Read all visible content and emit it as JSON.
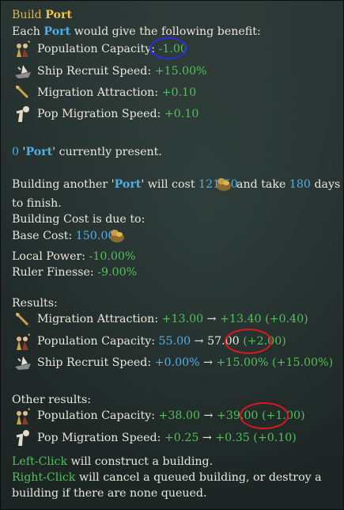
{
  "title": {
    "prefix": "Build",
    "name": "Port"
  },
  "benefit_intro": {
    "pre": "Each",
    "name": "Port",
    "post": "would give the following benefit:"
  },
  "benefits": [
    {
      "icon": "population-icon",
      "label": "Population Capacity:",
      "value": "-1.00"
    },
    {
      "icon": "ship-icon",
      "label": "Ship Recruit Speed:",
      "value": "+15.00%"
    },
    {
      "icon": "migration-icon",
      "label": "Migration Attraction:",
      "value": "+0.10"
    },
    {
      "icon": "pop-migration-icon",
      "label": "Pop Migration Speed:",
      "value": "+0.10"
    }
  ],
  "present": {
    "count": "0",
    "q1": "'",
    "name": "Port",
    "q2": "'",
    "text": "currently present."
  },
  "cost": {
    "pre": "Building another",
    "q1": "'",
    "name": "Port",
    "q2": "'",
    "mid": "will cost",
    "amount": "121.50",
    "and_take": "and take",
    "days": "180",
    "days_word": "days",
    "line2": "to finish."
  },
  "cost_due": {
    "heading": "Building Cost is due to:",
    "base_label": "Base Cost:",
    "base_value": "150.00",
    "local_label": "Local Power:",
    "local_value": "-10.00%",
    "ruler_label": "Ruler Finesse:",
    "ruler_value": "-9.00%"
  },
  "results": {
    "heading": "Results:",
    "rows": [
      {
        "icon": "migration-icon",
        "label": "Migration Attraction:",
        "from": "+13.00",
        "arrow": "→",
        "to": "+13.40",
        "delta": "(+0.40)"
      },
      {
        "icon": "population-icon",
        "label": "Population Capacity:",
        "from": "55.00",
        "arrow": "→",
        "to": "57.00",
        "delta": "(+2.00)"
      },
      {
        "icon": "ship-icon",
        "label": "Ship Recruit Speed:",
        "from": "+0.00%",
        "arrow": "→",
        "to": "+15.00%",
        "delta": "(+15.00%)"
      }
    ]
  },
  "other_results": {
    "heading": "Other results:",
    "rows": [
      {
        "icon": "population-icon",
        "label": "Population Capacity:",
        "from": "+38.00",
        "arrow": "→",
        "to": "+39.00",
        "delta": "(+1.00)"
      },
      {
        "icon": "pop-migration-icon",
        "label": "Pop Migration Speed:",
        "from": "+0.25",
        "arrow": "→",
        "to": "+0.35",
        "delta": "(+0.10)"
      }
    ]
  },
  "actions": {
    "left_key": "Left-Click",
    "left_text": "will construct a building.",
    "right_key": "Right-Click",
    "right_text": "will cancel a queued building, or destroy a",
    "right_text2": "building if there are none queued."
  },
  "colors": {
    "gold": "#e0b646",
    "blue": "#4fb0e8",
    "green": "#52c05a",
    "annotation_red": "#e0161c",
    "annotation_blue": "#2a2ce8"
  }
}
